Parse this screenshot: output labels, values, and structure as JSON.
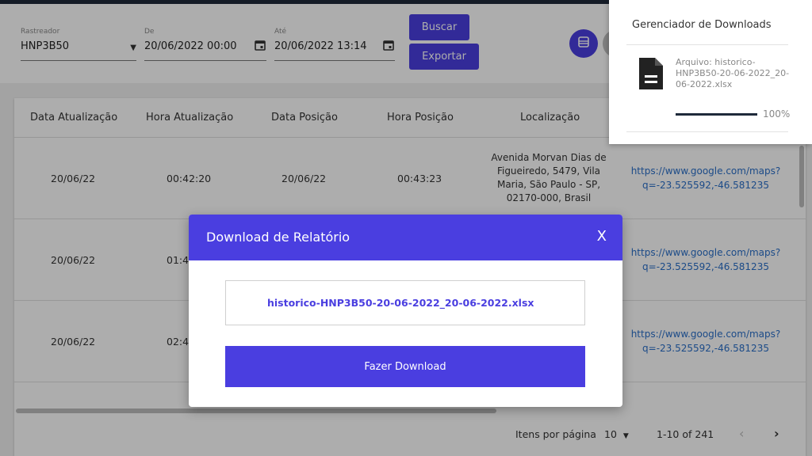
{
  "filters": {
    "tracker": {
      "label": "Rastreador",
      "value": "HNP3B50"
    },
    "from": {
      "label": "De",
      "value": "20/06/2022 00:00"
    },
    "to": {
      "label": "Até",
      "value": "20/06/2022 13:14"
    },
    "search_label": "Buscar",
    "export_label": "Exportar"
  },
  "table": {
    "headers": [
      "Data Atualização",
      "Hora Atualização",
      "Data Posição",
      "Hora Posição",
      "Localização"
    ],
    "rows": [
      {
        "date_upd": "20/06/22",
        "time_upd": "00:42:20",
        "date_pos": "20/06/22",
        "time_pos": "00:43:23",
        "location": "Avenida Morvan Dias de Figueiredo, 5479, Vila Maria, São Paulo - SP, 02170-000, Brasil",
        "link": "https://www.google.com/maps?q=-23.525592,-46.581235"
      },
      {
        "date_upd": "20/06/22",
        "time_upd": "01:4",
        "date_pos": "",
        "time_pos": "",
        "location": "",
        "link": "https://www.google.com/maps?q=-23.525592,-46.581235"
      },
      {
        "date_upd": "20/06/22",
        "time_upd": "02:4",
        "date_pos": "",
        "time_pos": "",
        "location": "",
        "link": "https://www.google.com/maps?q=-23.525592,-46.581235"
      }
    ]
  },
  "pagination": {
    "items_per_page_label": "Itens por página",
    "items_per_page": "10",
    "range": "1-10 of 241"
  },
  "downloads_panel": {
    "title": "Gerenciador de Downloads",
    "file_text": "Arquivo: historico-HNP3B50-20-06-2022_20-06-2022.xlsx",
    "percent": "100%",
    "progress": 1.0
  },
  "modal": {
    "title": "Download de Relatório",
    "close": "X",
    "filename": "historico-HNP3B50-20-06-2022_20-06-2022.xlsx",
    "download_label": "Fazer Download"
  },
  "colors": {
    "accent": "#4a3ee0",
    "link": "#2a6fc9"
  }
}
